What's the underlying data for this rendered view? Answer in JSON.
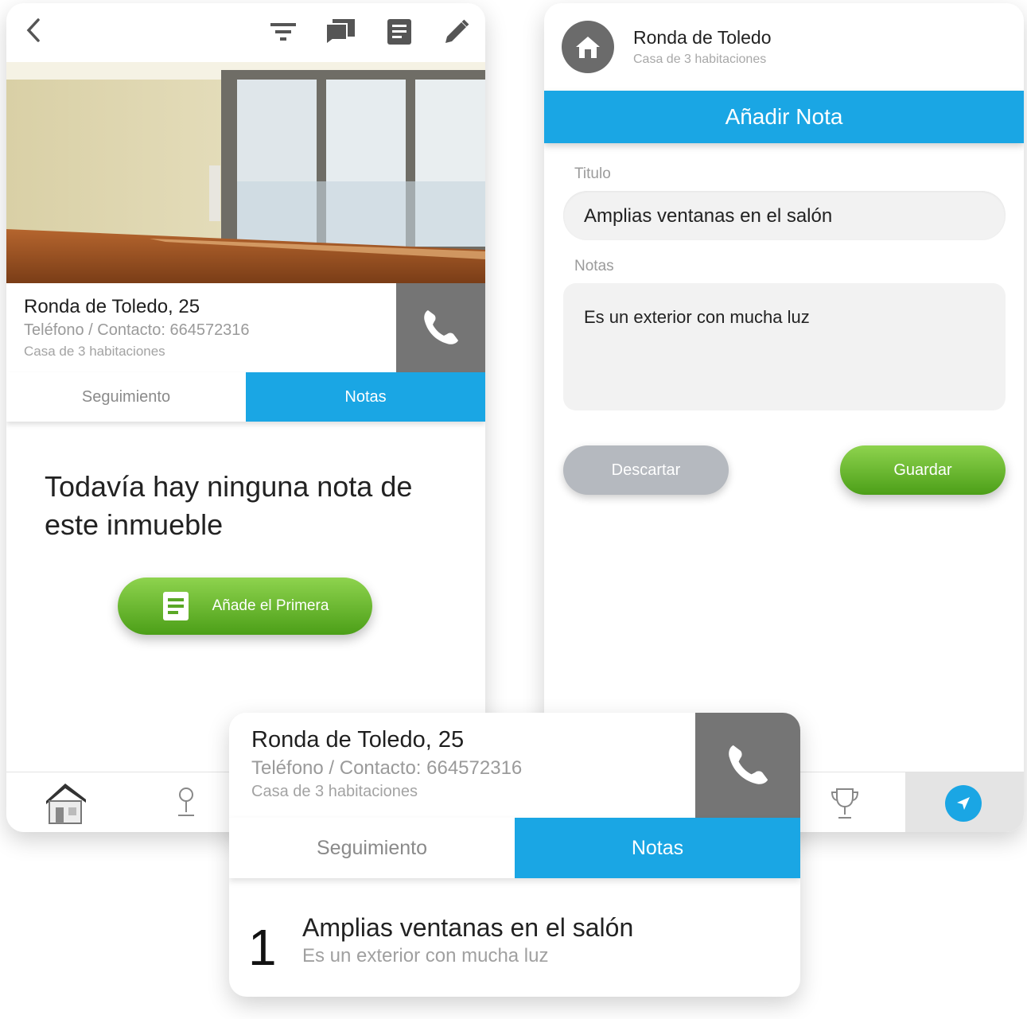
{
  "left_screen": {
    "property": {
      "address": "Ronda de Toledo, 25",
      "phone_line": "Teléfono / Contacto: 664572316",
      "type": "Casa de 3 habitaciones"
    },
    "tabs": [
      {
        "label": "Seguimiento",
        "active": false
      },
      {
        "label": "Notas",
        "active": true
      }
    ],
    "empty_message": "Todavía hay ninguna nota de este inmueble",
    "add_button_label": "Añade el Primera"
  },
  "right_screen": {
    "header": {
      "title": "Ronda de Toledo",
      "subtitle": "Casa de 3 habitaciones"
    },
    "banner_title": "Añadir Nota",
    "title_label": "Titulo",
    "title_value": "Amplias ventanas en el salón",
    "notes_label": "Notas",
    "notes_value": "Es un exterior con mucha luz",
    "discard_label": "Descartar",
    "save_label": "Guardar"
  },
  "bottom_card": {
    "property": {
      "address": "Ronda de Toledo, 25",
      "phone_line": "Teléfono / Contacto: 664572316",
      "type": "Casa de 3 habitaciones"
    },
    "tabs": [
      {
        "label": "Seguimiento",
        "active": false
      },
      {
        "label": "Notas",
        "active": true
      }
    ],
    "notes": [
      {
        "number": "1",
        "title": "Amplias ventanas en el salón",
        "body": "Es un exterior con mucha luz"
      }
    ]
  },
  "colors": {
    "accent_blue": "#1aa6e4",
    "green": "#5cb82a",
    "phone_grey": "#757575"
  }
}
